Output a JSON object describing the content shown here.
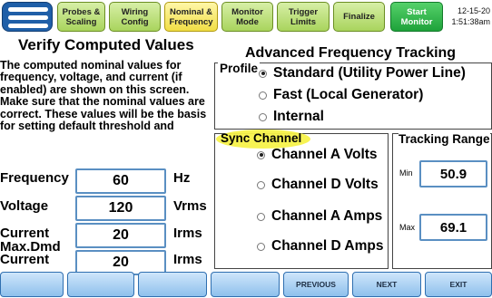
{
  "tabs": [
    {
      "label": "Probes & Scaling",
      "line1": "Probes &",
      "line2": "Scaling",
      "state": "normal"
    },
    {
      "label": "Wiring Config",
      "line1": "Wiring",
      "line2": "Config",
      "state": "normal"
    },
    {
      "label": "Nominal & Frequency",
      "line1": "Nominal &",
      "line2": "Frequency",
      "state": "active"
    },
    {
      "label": "Monitor Mode",
      "line1": "Monitor",
      "line2": "Mode",
      "state": "normal"
    },
    {
      "label": "Trigger Limits",
      "line1": "Trigger",
      "line2": "Limits",
      "state": "normal"
    },
    {
      "label": "Finalize",
      "line1": "Finalize",
      "line2": "",
      "state": "normal"
    }
  ],
  "start_button": {
    "line1": "Start",
    "line2": "Monitor"
  },
  "datetime": {
    "date": "12-15-20",
    "time": "1:51:38am"
  },
  "left": {
    "title": "Verify Computed Values",
    "description": "The computed nominal values for frequency, voltage, and current (if enabled) are shown on this screen. Make sure that the nominal values are correct. These values will be the basis for setting default threshold and",
    "rows": [
      {
        "label": "Frequency",
        "value": "60",
        "unit": "Hz"
      },
      {
        "label": "Voltage",
        "value": "120",
        "unit": "Vrms"
      },
      {
        "label": "Current",
        "value": "20",
        "unit": "Irms"
      },
      {
        "label": "Max.Dmd Current",
        "label1": "Max.Dmd",
        "label2": "Current",
        "value": "20",
        "unit": "Irms"
      }
    ]
  },
  "right": {
    "title": "Advanced Frequency Tracking",
    "profile": {
      "caption": "Profile",
      "options": [
        {
          "label": "Standard (Utility Power Line)",
          "selected": true
        },
        {
          "label": "Fast (Local Generator)",
          "selected": false
        },
        {
          "label": "Internal",
          "selected": false
        }
      ]
    },
    "sync": {
      "caption": "Sync Channel",
      "options": [
        {
          "label": "Channel A Volts",
          "selected": true
        },
        {
          "label": "Channel D Volts",
          "selected": false
        },
        {
          "label": "Channel A Amps",
          "selected": false
        },
        {
          "label": "Channel D Amps",
          "selected": false
        }
      ]
    },
    "tracking": {
      "caption": "Tracking Range",
      "min_label": "Min",
      "min_value": "50.9",
      "max_label": "Max",
      "max_value": "69.1"
    }
  },
  "bottom_buttons": [
    "",
    "",
    "",
    "",
    "PREVIOUS",
    "NEXT",
    "EXIT"
  ],
  "colors": {
    "tab_green": "#a9d45d",
    "tab_active": "#f1de45",
    "start_green": "#1ea23a",
    "highlight": "#f7f24a",
    "field_border": "#5a8fc2"
  }
}
